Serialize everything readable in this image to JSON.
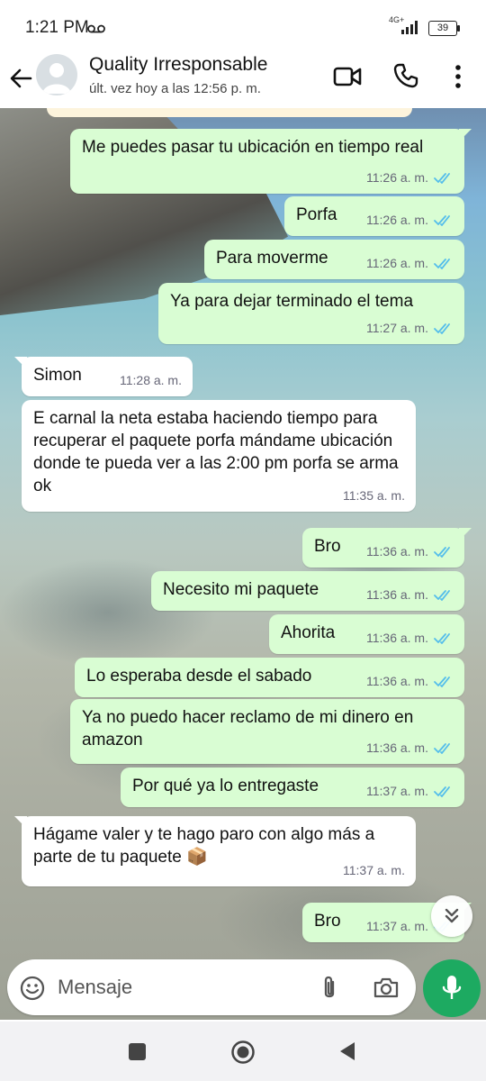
{
  "status_bar": {
    "time": "1:21 PM",
    "network": "4G+",
    "battery": "39"
  },
  "header": {
    "contact_name": "Quality Irresponsable",
    "last_seen": "últ. vez hoy a las 12:56 p. m."
  },
  "messages": [
    {
      "dir": "out",
      "text": "Me puedes pasar tu ubicación en tiempo real",
      "time": "11:26 a. m.",
      "read": true
    },
    {
      "dir": "out",
      "text": "Porfa",
      "time": "11:26 a. m.",
      "read": true
    },
    {
      "dir": "out",
      "text": "Para moverme",
      "time": "11:26 a. m.",
      "read": true
    },
    {
      "dir": "out",
      "text": "Ya para dejar terminado el tema",
      "time": "11:27 a. m.",
      "read": true
    },
    {
      "dir": "in",
      "text": "Simon",
      "time": "11:28 a. m."
    },
    {
      "dir": "in",
      "text": "E carnal la neta estaba haciendo tiempo para recuperar el paquete porfa mándame ubicación donde te pueda ver a las 2:00 pm porfa se arma ok",
      "time": "11:35 a. m."
    },
    {
      "dir": "out",
      "text": "Bro",
      "time": "11:36 a. m.",
      "read": true
    },
    {
      "dir": "out",
      "text": "Necesito mi paquete",
      "time": "11:36 a. m.",
      "read": true
    },
    {
      "dir": "out",
      "text": "Ahorita",
      "time": "11:36 a. m.",
      "read": true
    },
    {
      "dir": "out",
      "text": "Lo esperaba desde el sabado",
      "time": "11:36 a. m.",
      "read": true
    },
    {
      "dir": "out",
      "text": "Ya no puedo hacer reclamo de mi dinero en amazon",
      "time": "11:36 a. m.",
      "read": true
    },
    {
      "dir": "out",
      "text": "Por qué ya lo entregaste",
      "time": "11:37 a. m.",
      "read": true
    },
    {
      "dir": "in",
      "text": "Hágame valer y te hago paro con algo más a parte de tu paquete 📦",
      "time": "11:37 a. m."
    },
    {
      "dir": "out",
      "text": "Bro",
      "time": "11:37 a. m.",
      "read": true
    }
  ],
  "composer": {
    "placeholder": "Mensaje"
  },
  "colors": {
    "outgoing_bubble": "#d9fdd3",
    "incoming_bubble": "#ffffff",
    "read_ticks": "#53bdeb",
    "accent": "#1daa61"
  },
  "icons": [
    "back-arrow-icon",
    "video-call-icon",
    "phone-icon",
    "more-vert-icon",
    "emoji-icon",
    "attach-icon",
    "camera-icon",
    "mic-icon",
    "scroll-down-icon"
  ]
}
